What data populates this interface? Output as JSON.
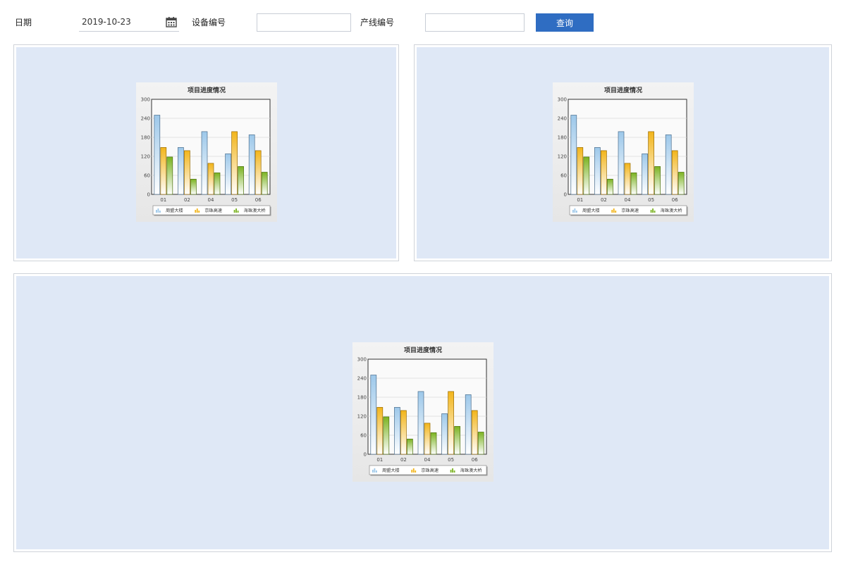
{
  "toolbar": {
    "date_label": "日期",
    "date_value": "2019-10-23",
    "device_label": "设备编号",
    "device_value": "",
    "line_label": "产线编号",
    "line_value": "",
    "query_label": "查询"
  },
  "colors": {
    "accent": "#2f6dc2",
    "panel_bg": "#dfe8f6",
    "series": [
      "#9dc8ea",
      "#f2b51b",
      "#7bb321"
    ]
  },
  "icons": {
    "date_picker": "calendar-icon"
  },
  "chart_data": [
    {
      "type": "bar",
      "title": "项目进度情况",
      "categories": [
        "01",
        "02",
        "04",
        "05",
        "06"
      ],
      "series": [
        {
          "name": "周盟大楼",
          "values": [
            250,
            148,
            198,
            128,
            188
          ]
        },
        {
          "name": "京珠高速",
          "values": [
            148,
            138,
            98,
            198,
            138
          ]
        },
        {
          "name": "海珠澳大桥",
          "values": [
            118,
            48,
            68,
            88,
            70
          ]
        }
      ],
      "ylim": [
        0,
        300
      ],
      "yticks": [
        "0",
        "60",
        "120",
        "180",
        "240",
        "300"
      ],
      "grid": true,
      "legend": "bottom"
    },
    {
      "type": "bar",
      "title": "项目进度情况",
      "categories": [
        "01",
        "02",
        "04",
        "05",
        "06"
      ],
      "series": [
        {
          "name": "周盟大楼",
          "values": [
            250,
            148,
            198,
            128,
            188
          ]
        },
        {
          "name": "京珠高速",
          "values": [
            148,
            138,
            98,
            198,
            138
          ]
        },
        {
          "name": "海珠澳大桥",
          "values": [
            118,
            48,
            68,
            88,
            70
          ]
        }
      ],
      "ylim": [
        0,
        300
      ],
      "yticks": [
        "0",
        "60",
        "120",
        "180",
        "240",
        "300"
      ],
      "grid": true,
      "legend": "bottom"
    },
    {
      "type": "bar",
      "title": "项目进度情况",
      "categories": [
        "01",
        "02",
        "04",
        "05",
        "06"
      ],
      "series": [
        {
          "name": "周盟大楼",
          "values": [
            250,
            148,
            198,
            128,
            188
          ]
        },
        {
          "name": "京珠高速",
          "values": [
            148,
            138,
            98,
            198,
            138
          ]
        },
        {
          "name": "海珠澳大桥",
          "values": [
            118,
            48,
            68,
            88,
            70
          ]
        }
      ],
      "ylim": [
        0,
        300
      ],
      "yticks": [
        "0",
        "60",
        "120",
        "180",
        "240",
        "300"
      ],
      "grid": true,
      "legend": "bottom"
    }
  ]
}
